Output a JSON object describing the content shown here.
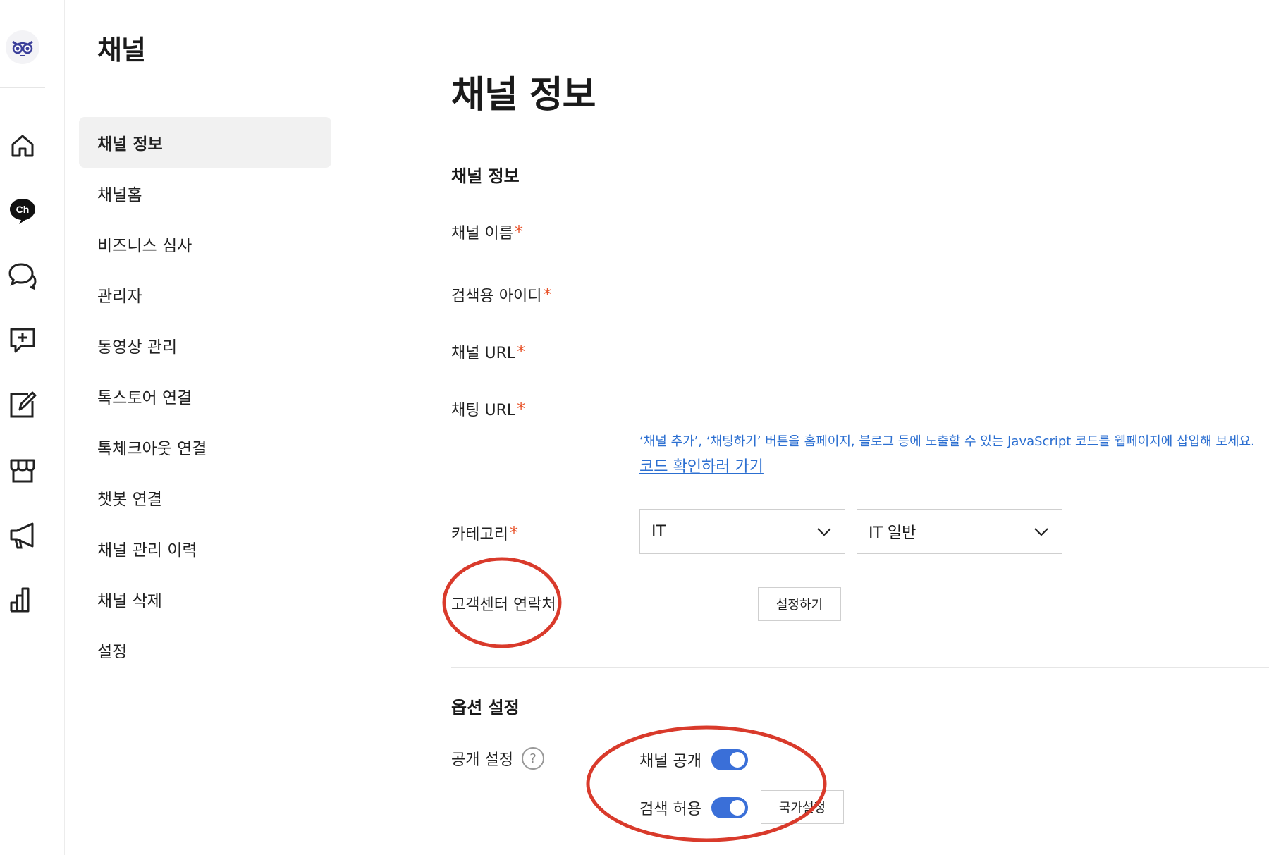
{
  "rail": {
    "icons": [
      "owl-logo-icon",
      "home-icon",
      "channel-ch-icon",
      "chat-bubbles-icon",
      "add-message-icon",
      "edit-icon",
      "store-icon",
      "megaphone-icon",
      "bar-chart-icon"
    ],
    "ch_text": "Ch"
  },
  "sidebar": {
    "title": "채널",
    "items": [
      {
        "label": "채널 정보",
        "active": true
      },
      {
        "label": "채널홈"
      },
      {
        "label": "비즈니스 심사"
      },
      {
        "label": "관리자"
      },
      {
        "label": "동영상 관리"
      },
      {
        "label": "톡스토어 연결"
      },
      {
        "label": "톡체크아웃 연결"
      },
      {
        "label": "챗봇 연결"
      },
      {
        "label": "채널 관리 이력"
      },
      {
        "label": "채널 삭제"
      },
      {
        "label": "설정"
      }
    ]
  },
  "main": {
    "page_title": "채널 정보",
    "info_section": {
      "title": "채널 정보",
      "fields": {
        "name": "채널 이름",
        "search_id": "검색용 아이디",
        "channel_url": "채널 URL",
        "chat_url": "채팅 URL",
        "category": "카테고리",
        "cs_contact": "고객센터 연락처"
      },
      "required_mark": "*",
      "hint": "‘채널 추가’, ‘채팅하기’ 버튼을 홈페이지, 블로그 등에 노출할 수 있는 JavaScript 코드를 웹페이지에 삽입해 보세요.",
      "hint_link": "코드 확인하러 가기",
      "category_primary": "IT",
      "category_secondary": "IT 일반",
      "setup_button": "설정하기"
    },
    "option_section": {
      "title": "옵션 설정",
      "visibility_label": "공개 설정",
      "help_glyph": "?",
      "channel_public": {
        "label": "채널 공개",
        "on": true
      },
      "search_allow": {
        "label": "검색 허용",
        "on": true
      },
      "country_button": "국가설정"
    }
  },
  "colors": {
    "accent_blue": "#3a6fd8",
    "link_blue": "#2c6fd1",
    "required_red": "#e8532a",
    "annotation_red": "#d93a2b"
  }
}
